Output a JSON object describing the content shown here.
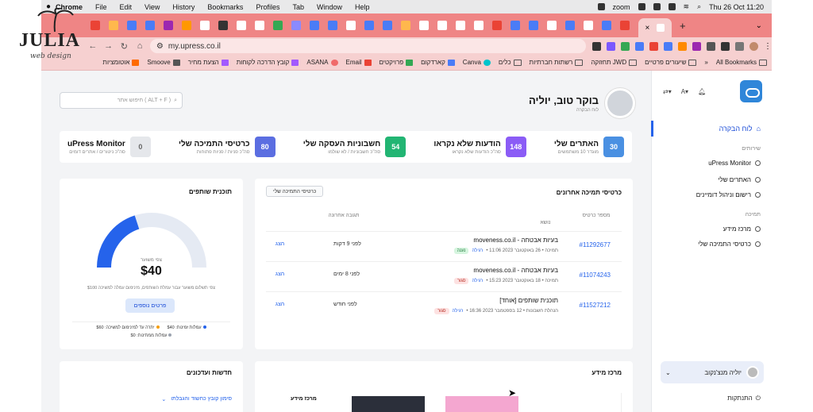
{
  "menubar": {
    "items": [
      "Chrome",
      "File",
      "Edit",
      "View",
      "History",
      "Bookmarks",
      "Profiles",
      "Tab",
      "Window",
      "Help"
    ],
    "zoom": "zoom",
    "clock": "Thu 26 Oct  11:20"
  },
  "browser": {
    "url": "my.upress.co.il",
    "tab_close": "×",
    "new_tab": "+",
    "tab_colors": [
      "#ea4335",
      "#ffb84d",
      "#4a7cf7",
      "#4a7cf7",
      "#9c27b0",
      "#ff9800",
      "#ffffff",
      "#333333",
      "#ffffff",
      "#ffffff",
      "#34a853",
      "#8a8aff",
      "#4a7cf7",
      "#4a7cf7",
      "#ffffff",
      "#4a7cf7",
      "#4a7cf7",
      "#ffb84d",
      "#ffffff",
      "#ffffff",
      "#ffffff",
      "#ffffff",
      "#ea4335",
      "#4a7cf7",
      "#4a7cf7",
      "#ffffff",
      "#4a7cf7",
      "#ffffff",
      "#4a7cf7",
      "#ea4335"
    ],
    "bookmarks": [
      "All Bookmarks",
      "שיעורים פרטיים",
      "תחזוקה JWD",
      "רשתות חברתיות",
      "כלים",
      "Canva",
      "קארדקום",
      "פרויקטים",
      "Email",
      "ASANA",
      "קובץ הדרכה לקוחות",
      "הצעת מחיר",
      "Smoove",
      "אוטומציות"
    ]
  },
  "sidebar": {
    "dashboard": "לוח הבקרה",
    "services_heading": "שירותים",
    "services": [
      "uPress Monitor",
      "האתרים שלי",
      "רישום וניהול דומיינים"
    ],
    "support_heading": "תמיכה",
    "support": [
      "מרכז מידע",
      "כרטיסי התמיכה שלי"
    ],
    "user_name": "יוליה מנצ'נקוב",
    "logout": "התנתקות"
  },
  "main": {
    "greeting": "בוקר טוב, יוליה",
    "greeting_sub": "לוח הבקרה",
    "search_placeholder": "חיפוש אתר ( ALT + F )",
    "stats": [
      {
        "value": "30",
        "title": "האתרים שלי",
        "desc": "מוגדר 10 משתמשים",
        "color": "#4a90e2"
      },
      {
        "value": "148",
        "title": "הודעות שלא נקראו",
        "desc": "סה\"כ הודעות שלא נקראו",
        "color": "#8b5cf6"
      },
      {
        "value": "54",
        "title": "חשבוניות העסקה שלי",
        "desc": "סה\"כ חשבוניות / לא שולמו",
        "color": "#22b573"
      },
      {
        "value": "80",
        "title": "כרטיסי התמיכה שלי",
        "desc": "סה\"כ פניות / פניות פתוחות",
        "color": "#5b6ee1"
      },
      {
        "value": "0",
        "title": "uPress Monitor",
        "desc": "סה\"כ ניטורים / אתרים דומים",
        "color": "#e5e7eb"
      }
    ],
    "tickets": {
      "title": "כרטיסי תמיכה אחרונים",
      "button": "כרטיסי התמיכה שלי",
      "col_number": "מספר כרטיס",
      "col_subject": "נושא",
      "col_response": "תגובה אחרונה",
      "rows": [
        {
          "number": "#11292677",
          "subject": "בעיות אבטחה - moveness.co.il",
          "meta": "תמיכה • 26 באוקטובר 2023 11:06 •",
          "tag": "רגילה",
          "status": "נענה",
          "status_color": "#1d7a3a",
          "status_bg": "#d6f5df",
          "response": "לפני 9 דקות",
          "view": "הצג"
        },
        {
          "number": "#11074243",
          "subject": "בעיות אבטחה - moveness.co.il",
          "meta": "תמיכה • 18 באוקטובר 2023 15:23 •",
          "tag": "רגילה",
          "status": "סגור",
          "status_color": "#b42318",
          "status_bg": "#fde2e2",
          "response": "לפני 8 ימים",
          "view": "הצג"
        },
        {
          "number": "#11527212",
          "subject": "תוכנית שותפים [אוחד]",
          "meta": "הנהלת חשבונות • 12 בספטמבר 2023 16:36 •",
          "tag": "רגילה",
          "status": "סגור",
          "status_color": "#b42318",
          "status_bg": "#fde2e2",
          "response": "לפני חודש",
          "view": "הצג"
        }
      ]
    },
    "partners": {
      "title": "תוכנית שותפים",
      "earned_label": "צפי משוער",
      "earned": "$40",
      "note": "צפי תשלום משוער עבור עמלת השותפים, מינימום עמלה למשיכה $100",
      "button": "פרטים נוספים",
      "progress": 0.4,
      "legend": [
        "עמלות זמינות: $40",
        "יתרה עד למינימום למשיכה: $60",
        "עמלות ממתינות: $0"
      ]
    },
    "news_title": "חדשות ועדכונים",
    "news_item": "סימון קובץ כחשוד והגבלתו",
    "help_title": "מרכז מידע",
    "help_sub": "מרכז מידע"
  },
  "decor": {
    "logo_text": "JULIA",
    "logo_sub": "web design"
  }
}
